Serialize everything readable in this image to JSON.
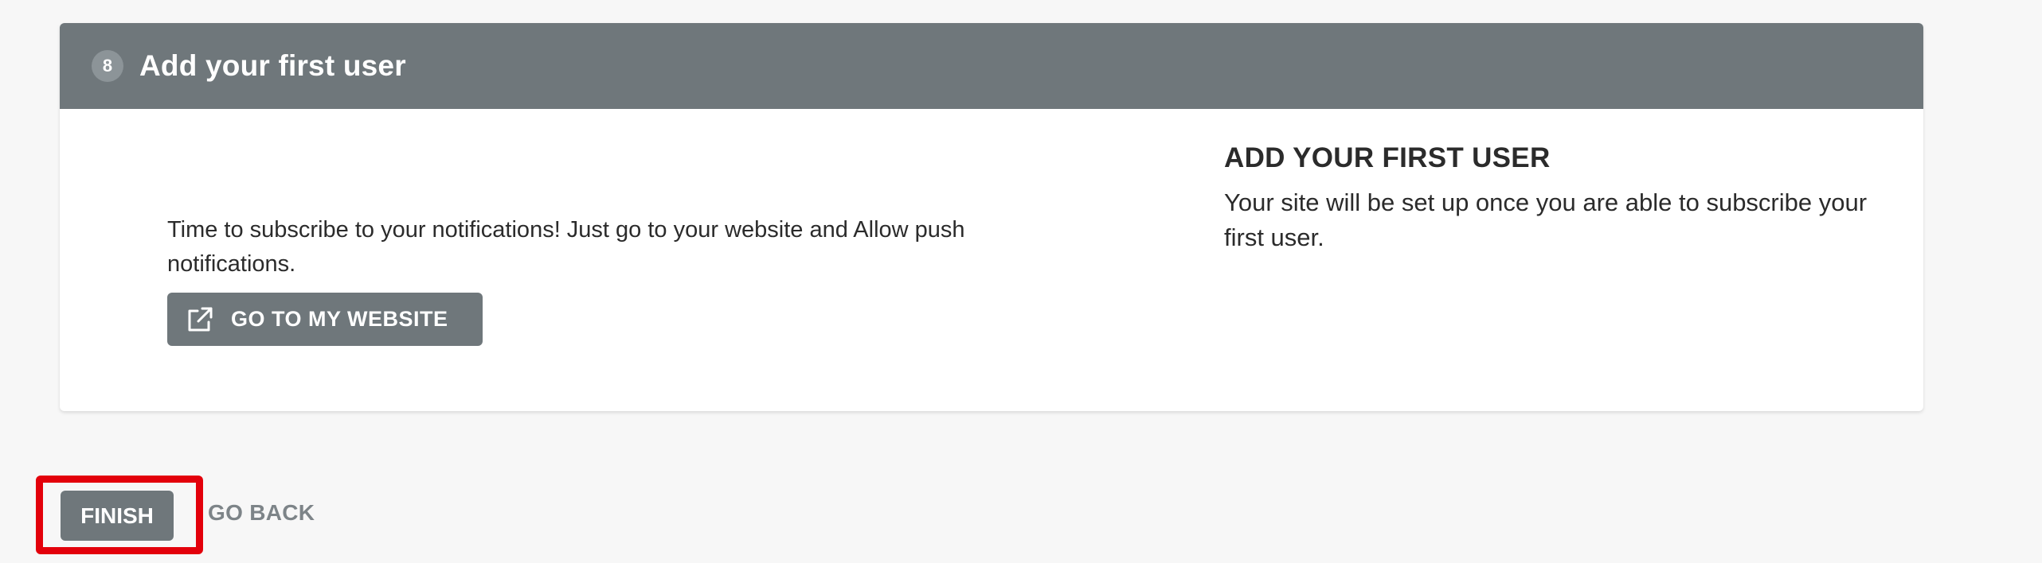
{
  "step": {
    "number": "8",
    "title": "Add your first user"
  },
  "left": {
    "instructions": "Time to subscribe to your notifications! Just go to your website and Allow push notifications.",
    "button_label": "GO TO MY WEBSITE",
    "button_icon": "external-link-icon"
  },
  "right": {
    "title": "ADD YOUR FIRST USER",
    "text": "Your site will be set up once you are able to subscribe your first user."
  },
  "footer": {
    "finish_label": "FINISH",
    "go_back_label": "GO BACK",
    "highlight_color": "#e3000b"
  },
  "colors": {
    "header_bg": "#6f777b",
    "button_bg": "#6f777b",
    "page_bg": "#f7f7f7"
  }
}
